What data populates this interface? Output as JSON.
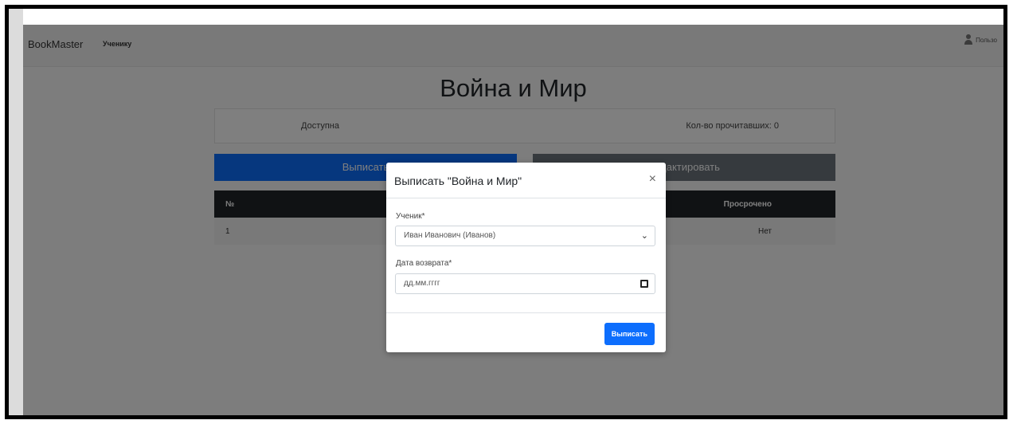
{
  "navbar": {
    "brand": "BookMaster",
    "link": "Ученику",
    "user": "Пользо"
  },
  "page": {
    "title": "Война и Мир",
    "stats": {
      "available": "Доступна",
      "read_count": "Кол-во прочитавших: 0"
    },
    "buttons": {
      "checkout": "Выписать",
      "edit": "Редактировать"
    },
    "table": {
      "headers": [
        "№",
        "Просрочено"
      ],
      "rows": [
        [
          "1",
          "Нет"
        ]
      ]
    }
  },
  "modal": {
    "title": "Выписать \"Война и Мир\"",
    "close": "×",
    "student_label": "Ученик*",
    "student_value": "Иван Иванович (Иванов)",
    "return_label": "Дата возврата*",
    "date_placeholder": "дд.мм.гггг",
    "submit": "Выписать"
  }
}
